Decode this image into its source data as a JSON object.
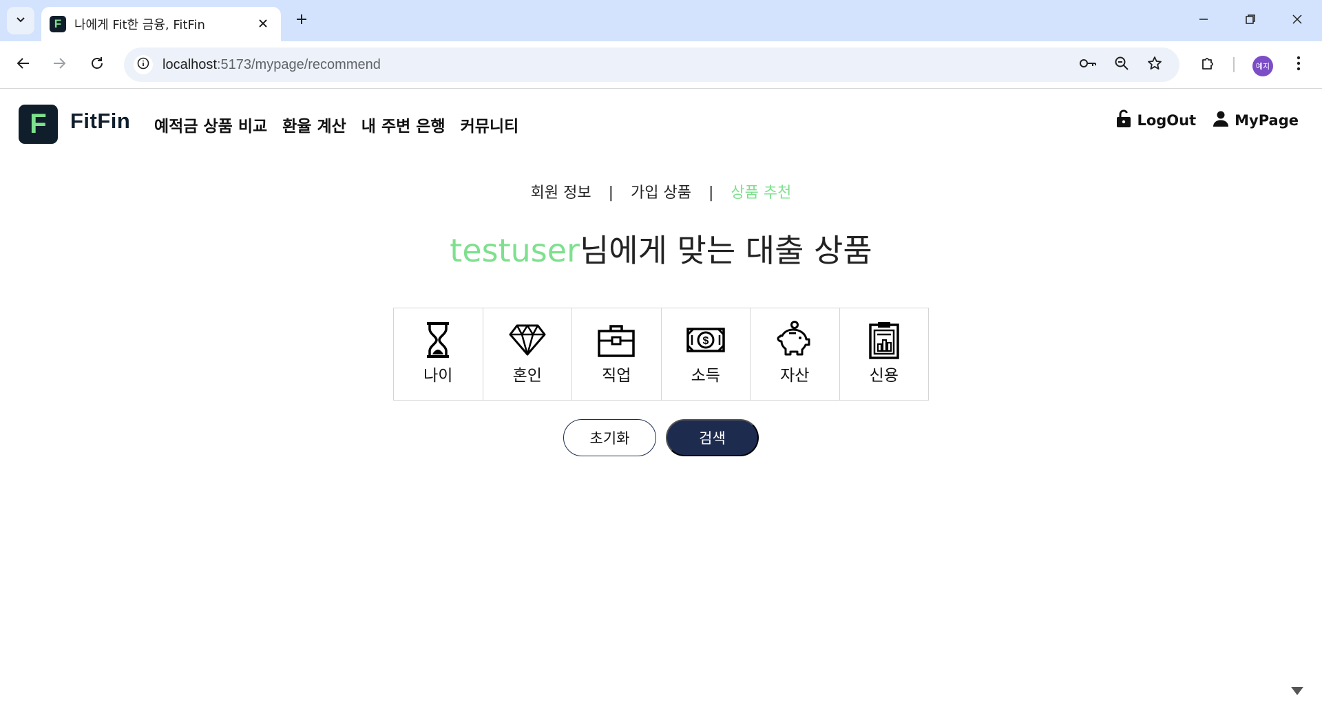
{
  "browser": {
    "tab": {
      "favicon": "F",
      "title": "나에게 Fit한 금융, FitFin"
    },
    "url": {
      "host": "localhost",
      "path": ":5173/mypage/recommend"
    },
    "avatar_label": "예지",
    "icons": {
      "tab_list": "chevron-down-icon",
      "tab_close": "close-icon",
      "new_tab": "plus-icon",
      "back": "arrow-left-icon",
      "forward": "arrow-right-icon",
      "reload": "reload-icon",
      "site_info": "info-icon",
      "password": "key-icon",
      "zoom": "zoom-out-icon",
      "bookmark": "star-icon",
      "extensions": "puzzle-icon",
      "menu": "kebab-menu-icon"
    }
  },
  "header": {
    "logo_letter": "F",
    "logo_text": "FitFin",
    "nav": [
      "예적금 상품 비교",
      "환율 계산",
      "내 주변 은행",
      "커뮤니티"
    ],
    "logout": "LogOut",
    "mypage": "MyPage"
  },
  "subnav": {
    "items": [
      "회원 정보",
      "가입 상품",
      "상품 추천"
    ],
    "separator": "|",
    "active_index": 2
  },
  "title": {
    "username": "testuser",
    "suffix": "님에게 맞는 대출 상품"
  },
  "categories": [
    {
      "label": "나이",
      "icon": "hourglass-icon"
    },
    {
      "label": "혼인",
      "icon": "diamond-icon"
    },
    {
      "label": "직업",
      "icon": "briefcase-icon"
    },
    {
      "label": "소득",
      "icon": "banknote-icon"
    },
    {
      "label": "자산",
      "icon": "piggy-bank-icon"
    },
    {
      "label": "신용",
      "icon": "clipboard-chart-icon"
    }
  ],
  "buttons": {
    "reset": "초기화",
    "search": "검색"
  },
  "colors": {
    "accent": "#7ee08e",
    "brand_dark": "#0f1e2a",
    "button_navy": "#1d2b4f",
    "chrome_tabbar": "#d3e3fd"
  }
}
